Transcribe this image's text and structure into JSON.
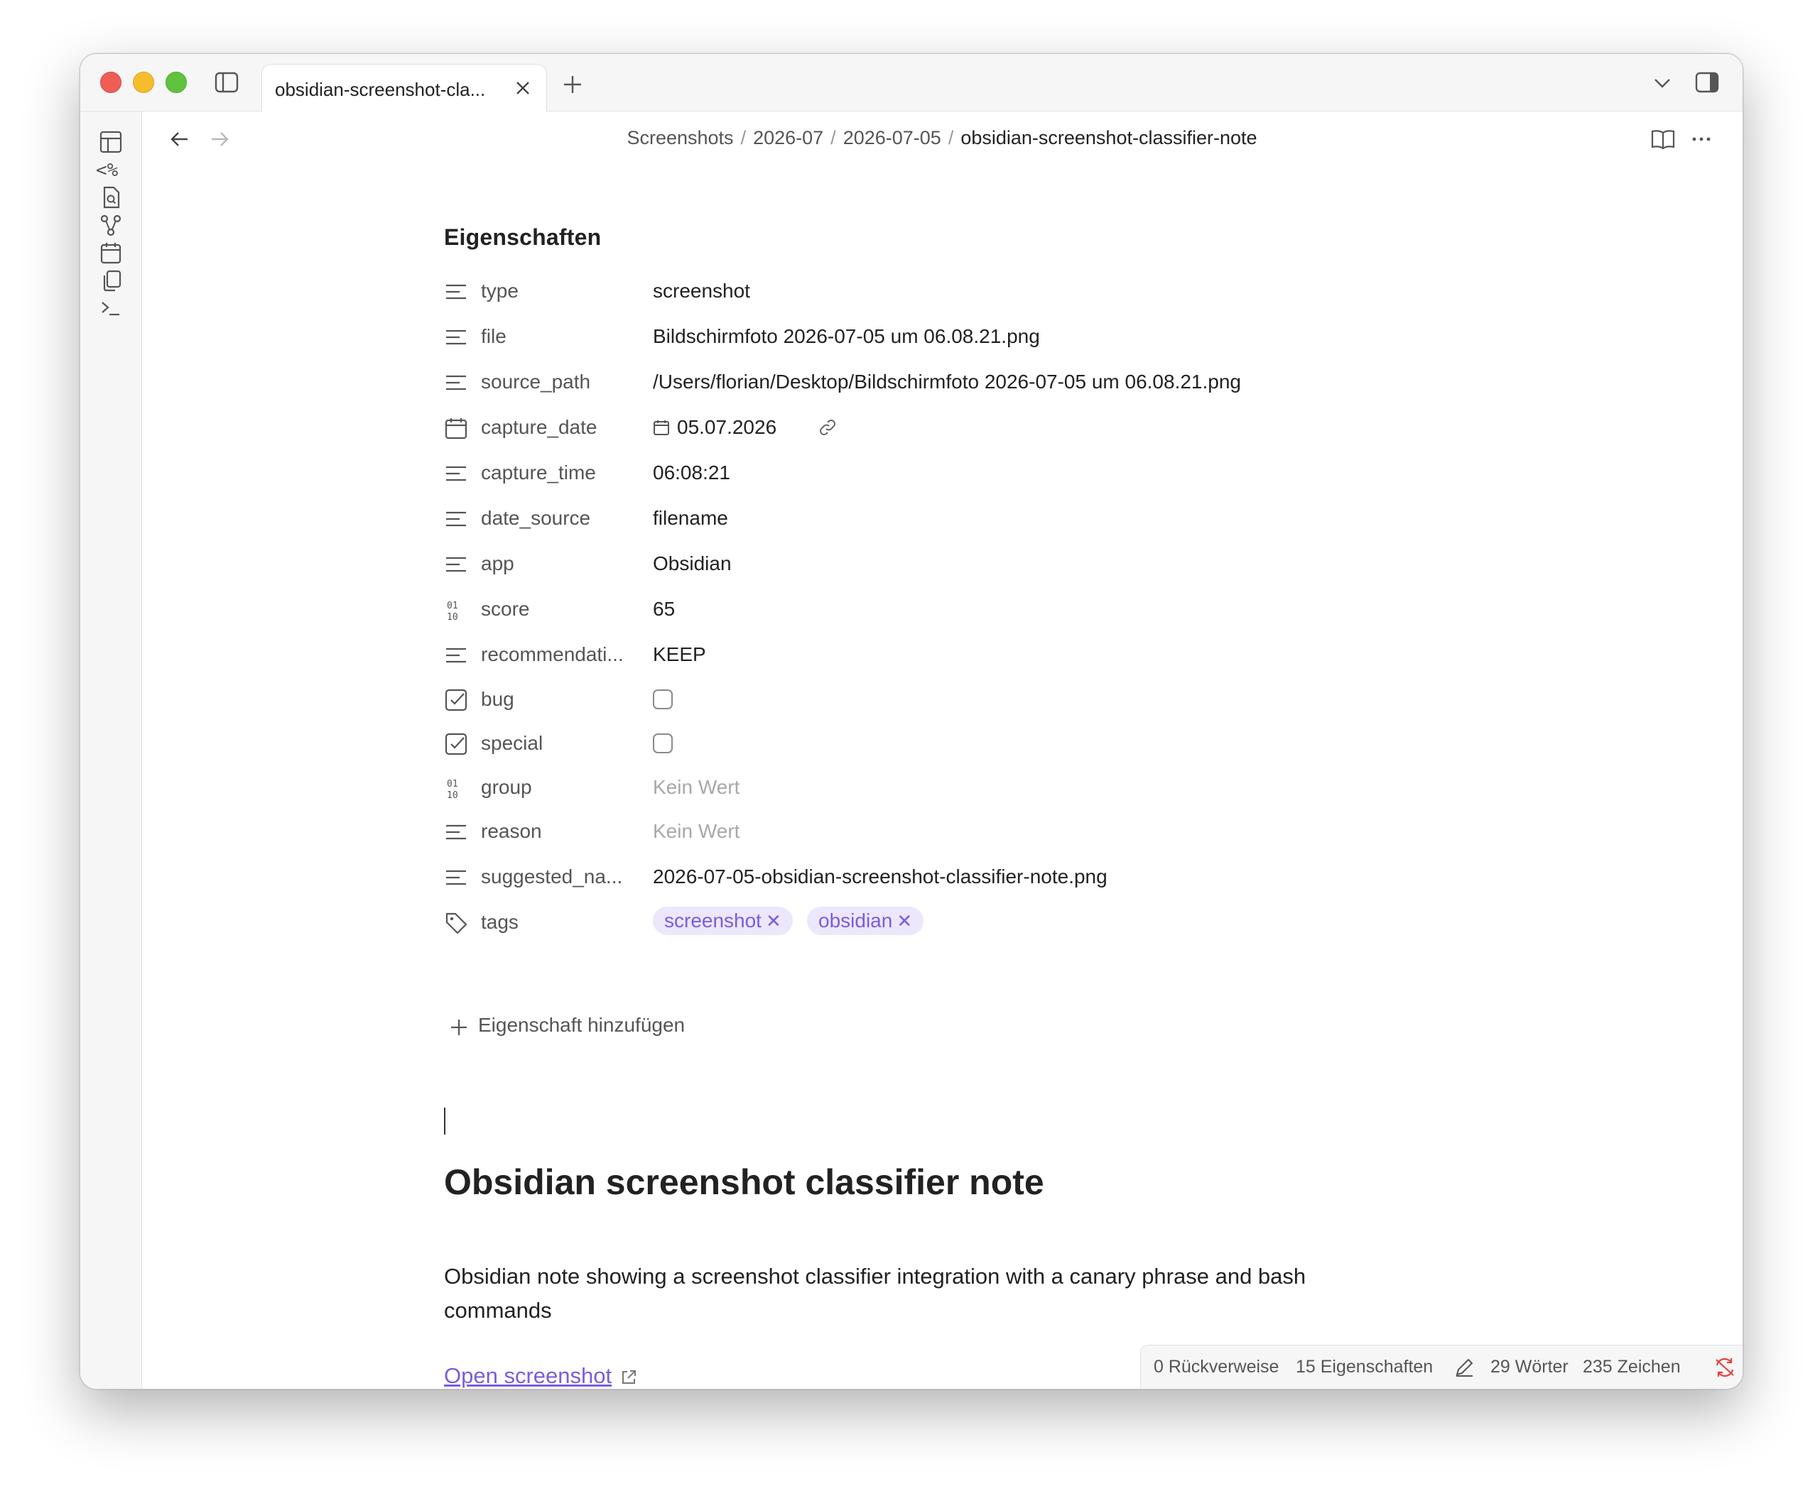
{
  "tab": {
    "title": "obsidian-screenshot-cla..."
  },
  "breadcrumb": {
    "parts": [
      "Screenshots",
      "2026-07",
      "2026-07-05"
    ],
    "current": "obsidian-screenshot-classifier-note",
    "separator": "/"
  },
  "properties": {
    "heading": "Eigenschaften",
    "items": [
      {
        "key": "type",
        "icon": "text-lines-icon",
        "value": "screenshot"
      },
      {
        "key": "file",
        "icon": "text-lines-icon",
        "value": "Bildschirmfoto 2026-07-05 um 06.08.21.png"
      },
      {
        "key": "source_path",
        "icon": "text-lines-icon",
        "value": "/Users/florian/Desktop/Bildschirmfoto 2026-07-05 um 06.08.21.png"
      },
      {
        "key": "capture_date",
        "icon": "calendar-icon",
        "value": "05.07.2026"
      },
      {
        "key": "capture_time",
        "icon": "text-lines-icon",
        "value": "06:08:21"
      },
      {
        "key": "date_source",
        "icon": "text-lines-icon",
        "value": "filename"
      },
      {
        "key": "app",
        "icon": "text-lines-icon",
        "value": "Obsidian"
      },
      {
        "key": "score",
        "icon": "number-icon",
        "value": "65"
      },
      {
        "key": "recommendati...",
        "icon": "text-lines-icon",
        "value": "KEEP"
      },
      {
        "key": "bug",
        "icon": "checkbox-icon",
        "value": false
      },
      {
        "key": "special",
        "icon": "checkbox-icon",
        "value": false
      },
      {
        "key": "group",
        "icon": "number-icon",
        "value": "Kein Wert"
      },
      {
        "key": "reason",
        "icon": "text-lines-icon",
        "value": "Kein Wert"
      },
      {
        "key": "suggested_na...",
        "icon": "text-lines-icon",
        "value": "2026-07-05-obsidian-screenshot-classifier-note.png"
      },
      {
        "key": "tags",
        "icon": "tag-icon",
        "values": [
          "screenshot",
          "obsidian"
        ]
      }
    ],
    "add_label": "Eigenschaft hinzufügen"
  },
  "note": {
    "title": "Obsidian screenshot classifier note",
    "body": "Obsidian note showing a screenshot classifier integration with a canary phrase and bash commands",
    "link_text": "Open screenshot"
  },
  "status": {
    "backlinks": "0 Rückverweise",
    "properties": "15 Eigenschaften",
    "words": "29 Wörter",
    "chars": "235 Zeichen"
  },
  "colors": {
    "accent": "#7a5ed9",
    "tag_bg": "#ece7fb",
    "sync_error": "#e0443e"
  }
}
